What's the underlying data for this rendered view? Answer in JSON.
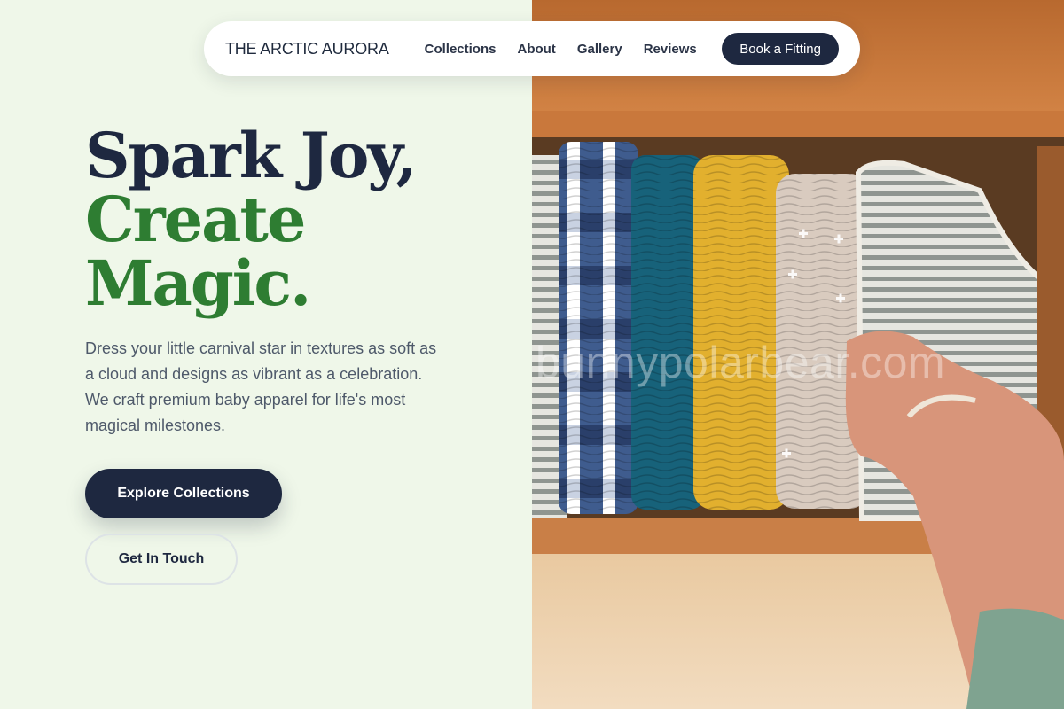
{
  "nav": {
    "brand": "THE ARCTIC AURORA",
    "links": [
      "Collections",
      "About",
      "Gallery",
      "Reviews"
    ],
    "cta": "Book a Fitting"
  },
  "hero": {
    "headline_line1": "Spark Joy,",
    "headline_line2": "Create",
    "headline_line3": "Magic.",
    "lead": "Dress your little carnival star in textures as soft as a cloud and designs as vibrant as a celebration. We craft premium baby apparel for life's most magical milestones.",
    "primary_button": "Explore Collections",
    "secondary_button": "Get In Touch"
  },
  "photo": {
    "description_icon": "folded-muslin-blankets-drawer-image",
    "watermark": "bunnypolarbear.com"
  },
  "colors": {
    "left_background": "#eff7e9",
    "navy": "#1e2840",
    "green": "#2e7d32",
    "body_text": "#4e596a"
  }
}
